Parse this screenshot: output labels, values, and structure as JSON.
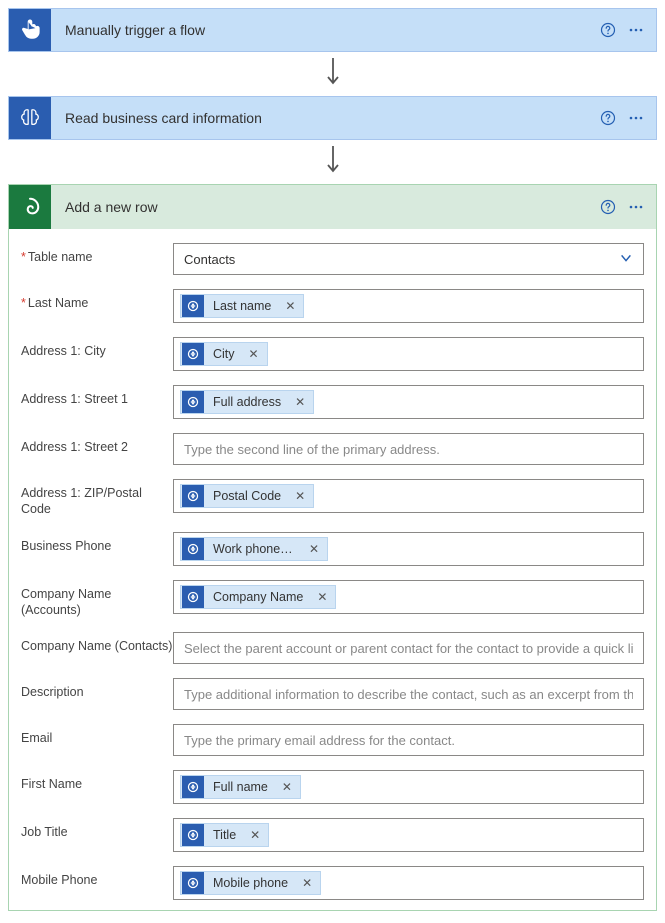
{
  "step1": {
    "label": "Manually trigger a flow"
  },
  "step2": {
    "label": "Read business card information"
  },
  "form": {
    "title": "Add a new row",
    "tableName": {
      "label": "Table name",
      "value": "Contacts"
    },
    "fields": {
      "lastName": {
        "label": "Last Name",
        "token": "Last name"
      },
      "city": {
        "label": "Address 1: City",
        "token": "City"
      },
      "street1": {
        "label": "Address 1: Street 1",
        "token": "Full address"
      },
      "street2": {
        "label": "Address 1: Street 2",
        "placeholder": "Type the second line of the primary address."
      },
      "zip": {
        "label": "Address 1: ZIP/Postal Code",
        "token": "Postal Code"
      },
      "bizPhone": {
        "label": "Business Phone",
        "token": "Work phone a..."
      },
      "companyAcc": {
        "label": "Company Name (Accounts)",
        "token": "Company Name"
      },
      "companyCon": {
        "label": "Company Name (Contacts)",
        "placeholder": "Select the parent account or parent contact for the contact to provide a quick link."
      },
      "desc": {
        "label": "Description",
        "placeholder": "Type additional information to describe the contact, such as an excerpt from the"
      },
      "email": {
        "label": "Email",
        "placeholder": "Type the primary email address for the contact."
      },
      "firstName": {
        "label": "First Name",
        "token": "Full name"
      },
      "jobTitle": {
        "label": "Job Title",
        "token": "Title"
      },
      "mobile": {
        "label": "Mobile Phone",
        "token": "Mobile phone"
      }
    }
  }
}
